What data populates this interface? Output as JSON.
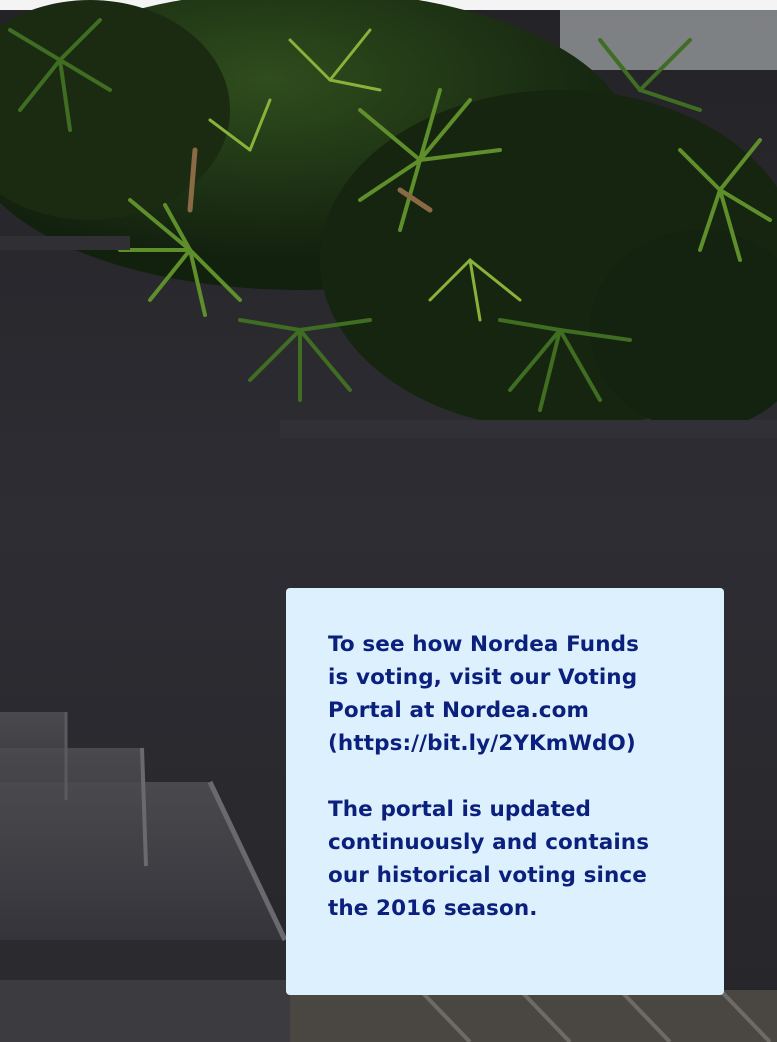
{
  "background": {
    "image_subject": "tropical-palm-plants-over-dark-wall-and-stone-steps",
    "colors": {
      "wall": "#2a2a2f",
      "foliage_dark": "#1f3a1a",
      "foliage_light": "#6f9a2c",
      "steps": "#3a3a3e"
    }
  },
  "info_box": {
    "background_color": "#dcf0fd",
    "text_color": "#0b1f7c",
    "paragraph_1": "To see how Nordea Funds\nis voting, visit our Voting\nPortal at Nordea.com\n(https://bit.ly/2YKmWdO)",
    "paragraph_2": "The portal is updated\ncontinuously and contains\nour historical voting since\nthe 2016 season."
  }
}
